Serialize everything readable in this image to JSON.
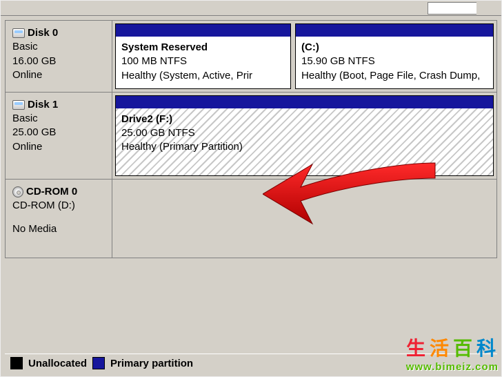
{
  "disks": [
    {
      "name": "Disk 0",
      "type": "Basic",
      "capacity": "16.00 GB",
      "status": "Online",
      "volumes": [
        {
          "name": "System Reserved",
          "size": "100 MB NTFS",
          "health": "Healthy (System, Active, Prir"
        },
        {
          "name": "  (C:)",
          "size": "15.90 GB NTFS",
          "health": "Healthy (Boot, Page File, Crash Dump,"
        }
      ]
    },
    {
      "name": "Disk 1",
      "type": "Basic",
      "capacity": "25.00 GB",
      "status": "Online",
      "volumes": [
        {
          "name": "Drive2  (F:)",
          "size": "25.00 GB NTFS",
          "health": "Healthy (Primary Partition)"
        }
      ]
    },
    {
      "name": "CD-ROM 0",
      "type": "CD-ROM (D:)",
      "capacity": "",
      "status": "No Media"
    }
  ],
  "legend": {
    "unallocated": "Unallocated",
    "primary": "Primary partition"
  },
  "watermark": {
    "cn1": "生",
    "cn2": "活",
    "cn3": "百",
    "cn4": "科",
    "url": "www.bimeiz.com"
  }
}
